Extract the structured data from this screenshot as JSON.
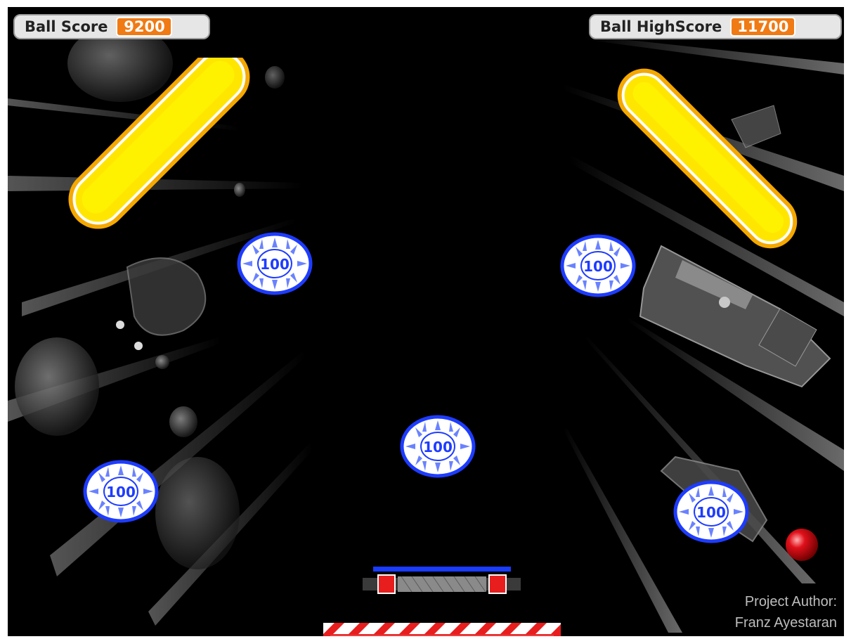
{
  "monitors": {
    "score": {
      "label": "Ball Score",
      "value": "9200"
    },
    "highscore": {
      "label": "Ball HighScore",
      "value": "11700"
    }
  },
  "bumpers": [
    {
      "value": "100"
    },
    {
      "value": "100"
    },
    {
      "value": "100"
    },
    {
      "value": "100"
    },
    {
      "value": "100"
    }
  ],
  "credits": {
    "line1": "Project Author:",
    "line2": "Franz Ayestaran"
  },
  "colors": {
    "monitor_value_bg": "#f07a14",
    "flipper_yellow": "#ffe600",
    "flipper_orange": "#f5a800",
    "bumper_blue": "#1e3cff",
    "ball_red": "#e0101a",
    "launcher_red": "#e81e1e"
  }
}
